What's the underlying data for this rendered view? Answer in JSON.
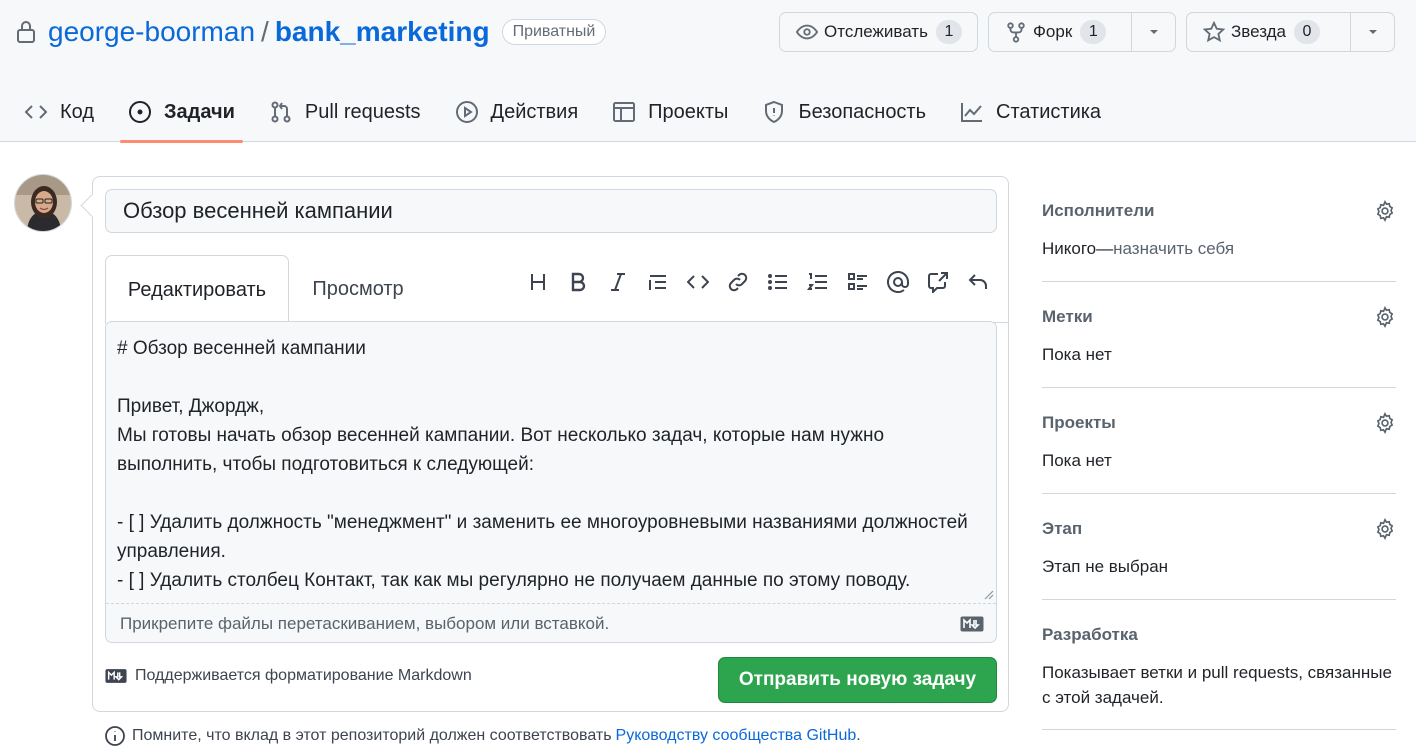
{
  "repo": {
    "owner": "george-boorman",
    "separator": "/",
    "name": "bank_marketing",
    "visibility": "Приватный"
  },
  "header_buttons": {
    "watch": {
      "label": "Отслеживать",
      "count": "1",
      "icon": "eye-icon"
    },
    "fork": {
      "label": "Форк",
      "count": "1",
      "icon": "fork-icon"
    },
    "star": {
      "label": "Звезда",
      "count": "0",
      "icon": "star-icon"
    }
  },
  "nav": {
    "items": [
      {
        "label": "Код",
        "icon": "code-icon"
      },
      {
        "label": "Задачи",
        "icon": "issue-icon",
        "active": true
      },
      {
        "label": "Pull requests",
        "icon": "pull-request-icon"
      },
      {
        "label": "Действия",
        "icon": "play-icon"
      },
      {
        "label": "Проекты",
        "icon": "table-icon"
      },
      {
        "label": "Безопасность",
        "icon": "shield-icon"
      },
      {
        "label": "Статистика",
        "icon": "graph-icon"
      }
    ]
  },
  "issue_form": {
    "title_value": "Обзор весенней кампании",
    "tabs": {
      "edit": "Редактировать",
      "preview": "Просмотр"
    },
    "body_value": "# Обзор весенней кампании\n\nПривет, Джордж,\nМы готовы начать обзор весенней кампании. Вот несколько задач, которые нам нужно выполнить, чтобы подготовиться к следующей:\n\n- [ ] Удалить должность \"менеджмент\" и заменить ее многоуровневыми названиями должностей управления.\n- [ ] Удалить столбец Контакт, так как мы регулярно не получаем данные по этому поводу.",
    "attach_hint": "Прикрепите файлы перетаскиванием, выбором или вставкой.",
    "markdown_note": "Поддерживается форматирование Markdown",
    "submit_label": "Отправить новую задачу"
  },
  "footer_note": {
    "text": "Помните, что вклад в этот репозиторий должен соответствовать",
    "link": "Руководству сообщества GitHub",
    "end": "."
  },
  "sidebar": {
    "assignees": {
      "title": "Исполнители",
      "value": "Никого—",
      "action": "назначить себя"
    },
    "labels": {
      "title": "Метки",
      "value": "Пока нет"
    },
    "projects": {
      "title": "Проекты",
      "value": "Пока нет"
    },
    "milestone": {
      "title": "Этап",
      "value": "Этап не выбран"
    },
    "development": {
      "title": "Разработка",
      "value": "Показывает ветки и pull requests, связанные с этой задачей."
    }
  },
  "colors": {
    "link": "#0969da",
    "submit": "#2da44e",
    "active_tab_underline": "#fd8c73"
  }
}
